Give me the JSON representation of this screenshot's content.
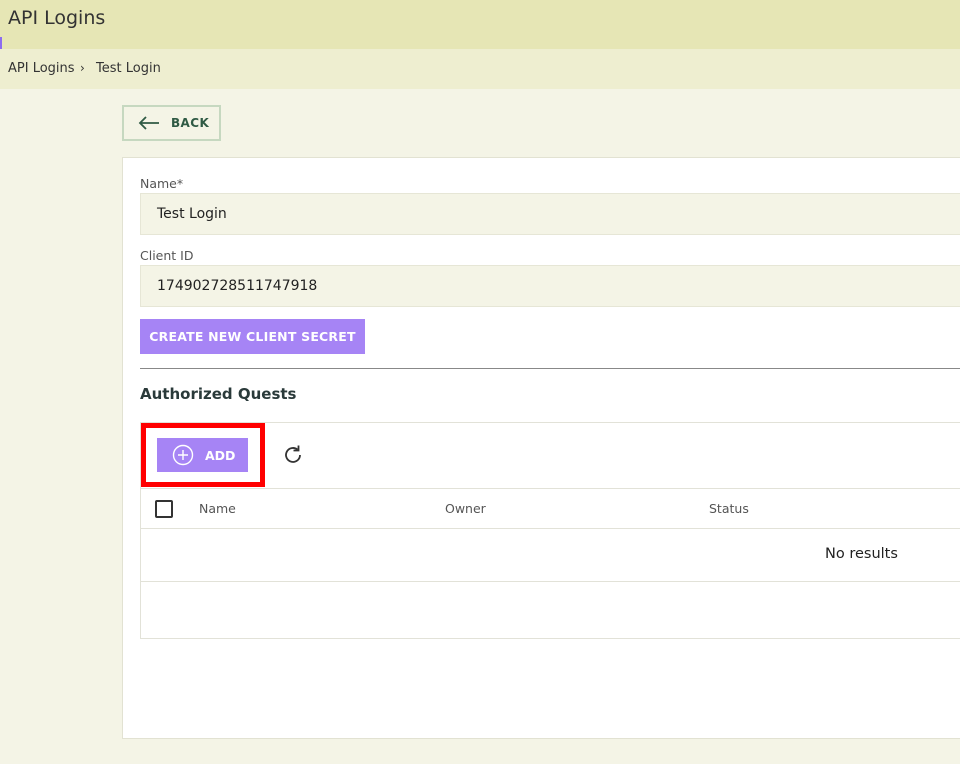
{
  "header": {
    "title": "API Logins"
  },
  "breadcrumb": {
    "items": [
      "API Logins",
      "Test Login"
    ],
    "separator": "›"
  },
  "back_button": {
    "label": "BACK"
  },
  "form": {
    "name": {
      "label": "Name",
      "required_mark": "*",
      "value": "Test Login"
    },
    "client_id": {
      "label": "Client ID",
      "value": "174902728511747918"
    },
    "secret_button": "CREATE NEW CLIENT SECRET"
  },
  "authorized": {
    "title": "Authorized Quests",
    "add_label": "ADD",
    "columns": [
      "Name",
      "Owner",
      "Status"
    ],
    "empty_message": "No results"
  },
  "colors": {
    "accent": "#a684f5",
    "highlight": "#ff0000",
    "header_bg": "#e6e6b5"
  },
  "icons": [
    "arrow-left-icon",
    "plus-circle-icon",
    "refresh-icon",
    "chevron-right-icon"
  ]
}
